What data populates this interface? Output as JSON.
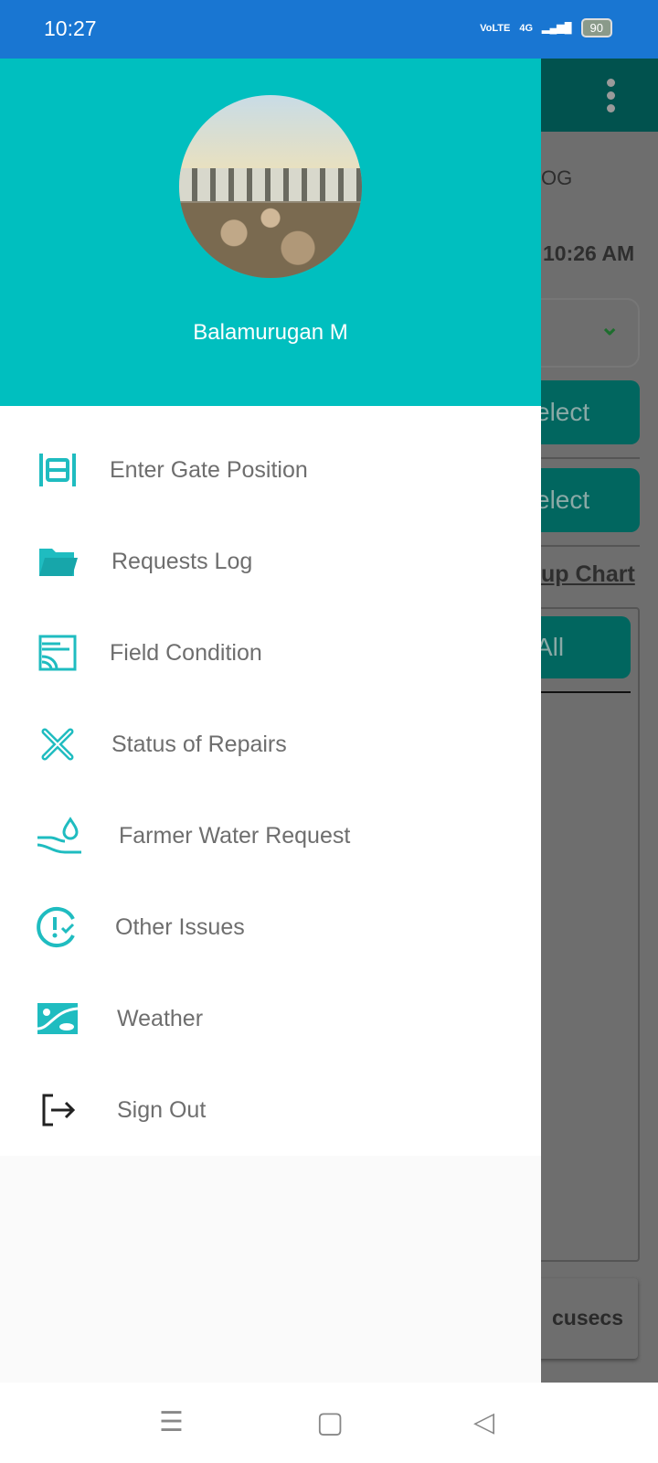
{
  "status_bar": {
    "time": "10:27",
    "network": "VoLTE",
    "signal": "4G",
    "battery": "90"
  },
  "background": {
    "tab_text": "OG",
    "time_text": "10:26 AM",
    "select_1": "elect",
    "select_2": "elect",
    "chart_link": "up Chart",
    "all_button": "All",
    "unit_text": "cusecs"
  },
  "drawer": {
    "user_name": "Balamurugan M",
    "items": [
      {
        "label": "Enter Gate Position",
        "icon": "gate-icon"
      },
      {
        "label": "Requests Log",
        "icon": "folder-icon"
      },
      {
        "label": "Field Condition",
        "icon": "field-icon"
      },
      {
        "label": "Status of Repairs",
        "icon": "tools-icon"
      },
      {
        "label": "Farmer Water Request",
        "icon": "water-hand-icon"
      },
      {
        "label": "Other Issues",
        "icon": "issue-clock-icon"
      },
      {
        "label": "Weather",
        "icon": "weather-icon"
      },
      {
        "label": "Sign Out",
        "icon": "sign-out-icon"
      }
    ]
  },
  "colors": {
    "accent": "#00bfbf",
    "status_bar": "#1976d2",
    "icon": "#1fbcc0"
  }
}
